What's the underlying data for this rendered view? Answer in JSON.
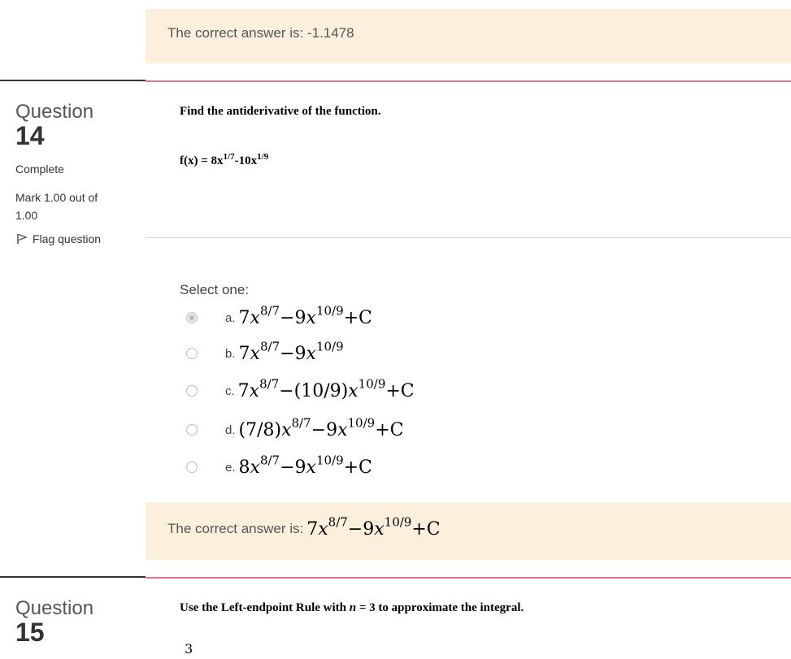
{
  "top_feedback": {
    "prefix": "The correct answer is: ",
    "value": "-1.1478"
  },
  "q14": {
    "label": "Question",
    "number": "14",
    "status": "Complete",
    "mark_line1": "Mark 1.00 out of",
    "mark_line2": "1.00",
    "flag_label": "Flag question",
    "prompt": "Find the antiderivative of the function.",
    "function_lhs": "f(x) = 8x",
    "exp1": "1/7",
    "mid": "-10x",
    "exp2": "1/9",
    "select_one": "Select one:",
    "options": [
      {
        "letter": "a.",
        "checked": true
      },
      {
        "letter": "b.",
        "checked": false
      },
      {
        "letter": "c.",
        "checked": false
      },
      {
        "letter": "d.",
        "checked": false
      },
      {
        "letter": "e.",
        "checked": false
      }
    ],
    "math": {
      "a": {
        "c": "7",
        "v": "x",
        "e1": "8/7",
        "m": "−9",
        "v2": "x",
        "e2": "10/9",
        "t": "+C"
      },
      "b": {
        "c": "7",
        "v": "x",
        "e1": "8/7",
        "m": "−9",
        "v2": "x",
        "e2": "10/9",
        "t": ""
      },
      "c": {
        "c": "7",
        "v": "x",
        "e1": "8/7",
        "m": "−(10/9)",
        "v2": "x",
        "e2": "10/9",
        "t": "+C"
      },
      "d": {
        "c": "(7/8)",
        "v": "x",
        "e1": "8/7",
        "m": "−9",
        "v2": "x",
        "e2": "10/9",
        "t": "+C"
      },
      "e": {
        "c": "8",
        "v": "x",
        "e1": "8/7",
        "m": "−9",
        "v2": "x",
        "e2": "10/9",
        "t": "+C"
      },
      "answer": {
        "c": "7",
        "v": "x",
        "e1": "8/7",
        "m": "−9",
        "v2": "x",
        "e2": "10/9",
        "t": "+C"
      }
    },
    "feedback_prefix": "The correct answer is: "
  },
  "q15": {
    "label": "Question",
    "number": "15",
    "prompt_a": "Use the Left-endpoint Rule with ",
    "prompt_n": "n",
    "prompt_b": " = 3 to approximate the integral.",
    "bound": "3"
  }
}
